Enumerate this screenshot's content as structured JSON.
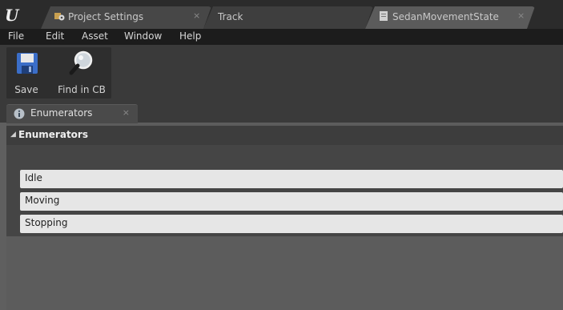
{
  "tabs": [
    {
      "label": "Project Settings",
      "close": "×",
      "icon": "gear-icon"
    },
    {
      "label": "Track"
    },
    {
      "label": "SedanMovementState",
      "close": "×",
      "icon": "enum-asset-icon"
    }
  ],
  "menu": [
    "File",
    "Edit",
    "Asset",
    "Window",
    "Help"
  ],
  "toolbar": {
    "save_label": "Save",
    "find_label": "Find in CB"
  },
  "details_tab": {
    "label": "Enumerators",
    "close": "×"
  },
  "category": {
    "label": "Enumerators",
    "arrow": "◢"
  },
  "enumerators": [
    "Idle",
    "Moving",
    "Stopping"
  ],
  "colors": {
    "accent": "#e0c030",
    "row_bg": "#e6e6e6"
  }
}
